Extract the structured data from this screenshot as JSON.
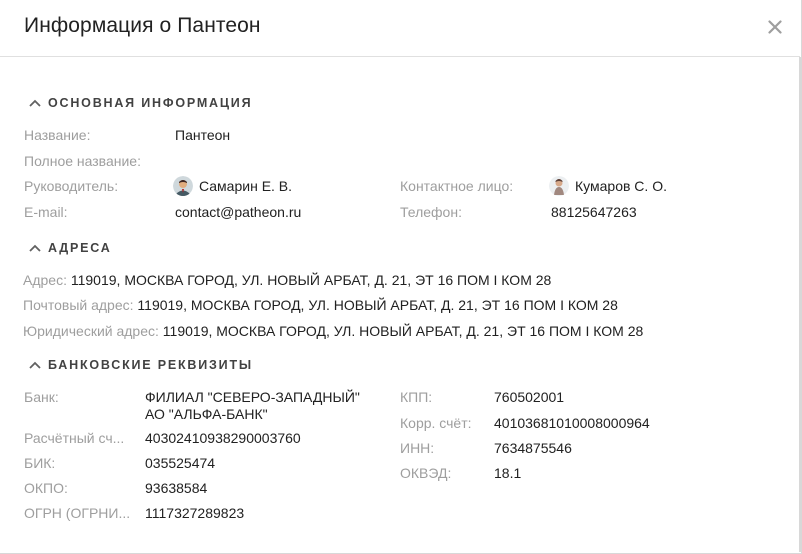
{
  "dialog": {
    "title": "Информация о Пантеон",
    "close_icon": "close-icon"
  },
  "basic": {
    "heading": "ОСНОВНАЯ ИНФОРМАЦИЯ",
    "name_label": "Название:",
    "name_value": "Пантеон",
    "full_name_label": "Полное название:",
    "full_name_value": "",
    "manager_label": "Руководитель:",
    "manager_value": "Самарин Е. В.",
    "contact_label": "Контактное лицо:",
    "contact_value": "Кумаров С. О.",
    "email_label": "E-mail:",
    "email_value": "contact@patheon.ru",
    "phone_label": "Телефон:",
    "phone_value": "88125647263"
  },
  "addresses": {
    "heading": "АДРЕСА",
    "address_label": "Адрес:",
    "address_value": "119019, МОСКВА ГОРОД, УЛ. НОВЫЙ АРБАТ, Д. 21, ЭТ 16 ПОМ I КОМ 28",
    "postal_label": "Почтовый адрес:",
    "postal_value": "119019, МОСКВА ГОРОД, УЛ. НОВЫЙ АРБАТ, Д. 21, ЭТ 16 ПОМ I КОМ 28",
    "legal_label": "Юридический адрес:",
    "legal_value": "119019, МОСКВА ГОРОД, УЛ. НОВЫЙ АРБАТ, Д. 21, ЭТ 16 ПОМ I КОМ 28"
  },
  "bank": {
    "heading": "БАНКОВСКИЕ РЕКВИЗИТЫ",
    "bank_label": "Банк:",
    "bank_value_line1": "ФИЛИАЛ \"СЕВЕРО-ЗАПАДНЫЙ\"",
    "bank_value_line2": "АО \"АЛЬФА-БАНК\"",
    "account_label": "Расчётный сч...",
    "account_value": "40302410938290003760",
    "bik_label": "БИК:",
    "bik_value": "035525474",
    "okpo_label": "ОКПО:",
    "okpo_value": "93638584",
    "ogrn_label": "ОГРН (ОГРНИ...",
    "ogrn_value": "1117327289823",
    "kpp_label": "КПП:",
    "kpp_value": "760502001",
    "corr_label": "Корр. счёт:",
    "corr_value": "40103681010008000964",
    "inn_label": "ИНН:",
    "inn_value": "7634875546",
    "okved_label": "ОКВЭД:",
    "okved_value": "18.1"
  },
  "icons": {
    "collapse": "chevron-up-icon",
    "manager_avatar": "avatar",
    "contact_avatar": "avatar"
  }
}
